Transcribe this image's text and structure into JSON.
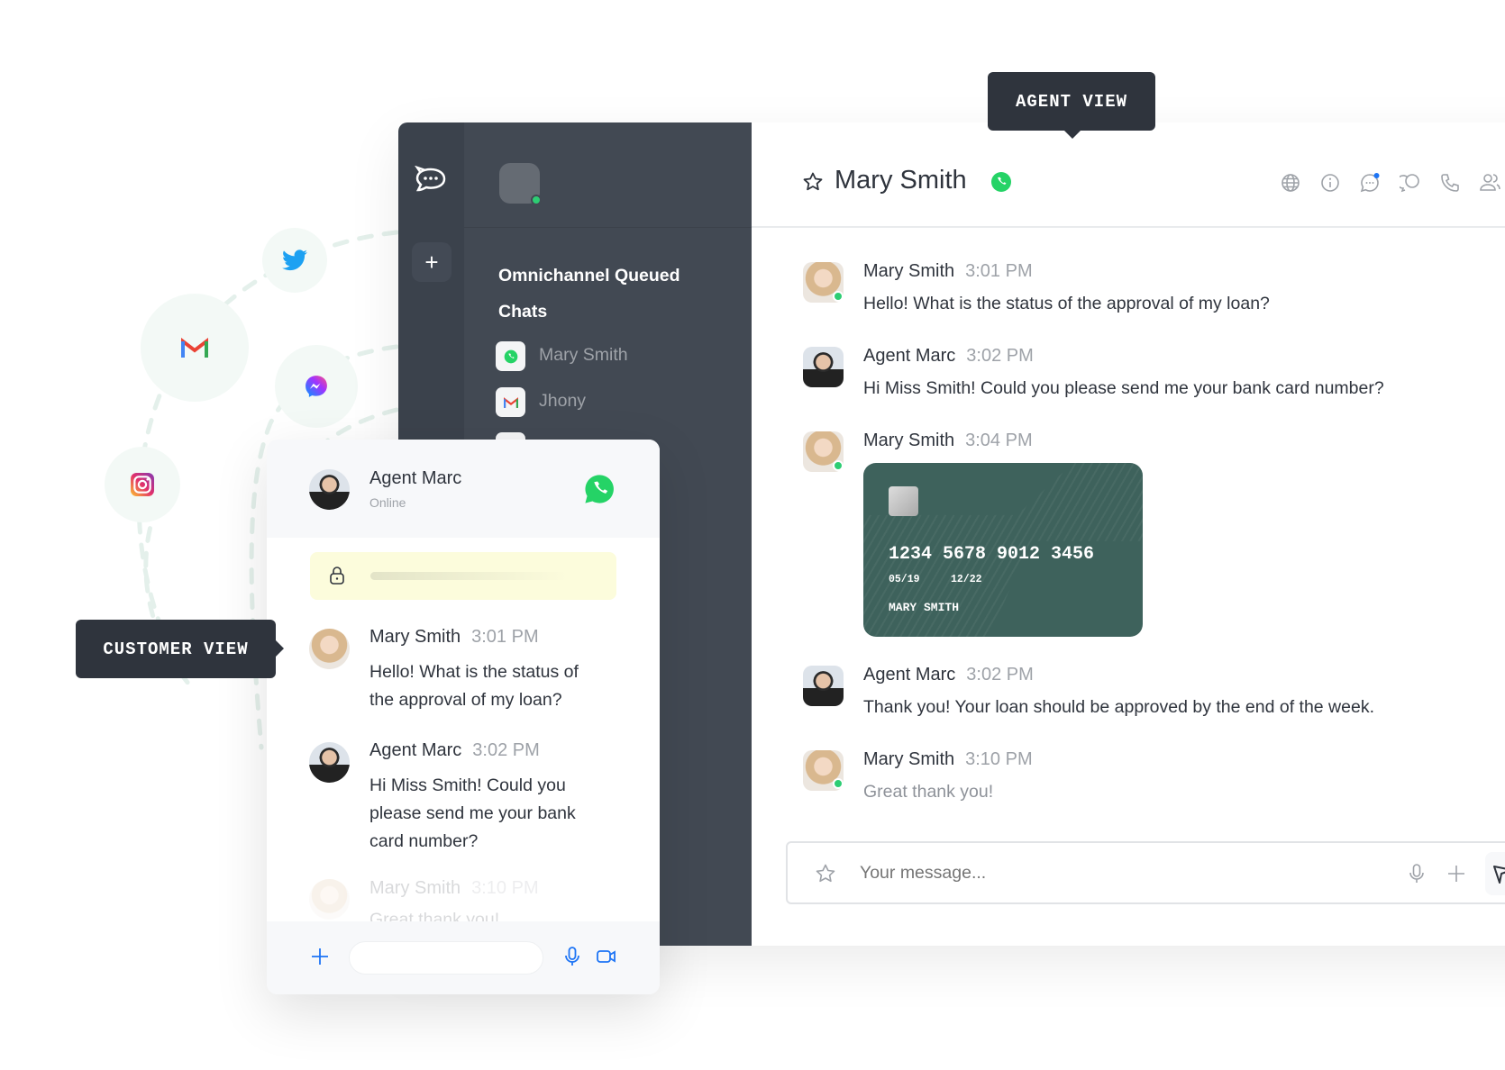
{
  "labels": {
    "agent_view": "AGENT VIEW",
    "customer_view": "CUSTOMER VIEW"
  },
  "social_icons": [
    "twitter-icon",
    "gmail-icon",
    "messenger-icon",
    "instagram-icon"
  ],
  "sidebar": {
    "title": "Omnichannel Queued Chats",
    "items": [
      {
        "label": "Mary Smith",
        "icon": "whatsapp-icon"
      },
      {
        "label": "Jhony",
        "icon": "gmail-icon"
      }
    ]
  },
  "header": {
    "name": "Mary Smith",
    "channel_icon": "whatsapp-icon",
    "actions": [
      "globe-icon",
      "info-icon",
      "discussion-icon",
      "threads-icon",
      "phone-icon",
      "members-icon"
    ]
  },
  "messages": [
    {
      "name": "Mary Smith",
      "time": "3:01 PM",
      "text": "Hello! What is the status of the approval of my loan?"
    },
    {
      "name": "Agent Marc",
      "time": "3:02 PM",
      "text": "Hi Miss Smith! Could you please send me your bank card number?"
    },
    {
      "name": "Mary Smith",
      "time": "3:04 PM",
      "text": ""
    },
    {
      "name": "Agent Marc",
      "time": "3:02 PM",
      "text": "Thank you! Your loan should be approved by the end of the week."
    },
    {
      "name": "Mary Smith",
      "time": "3:10 PM",
      "text": "Great thank you!"
    }
  ],
  "card": {
    "number": "1234 5678 9012 3456",
    "valid_from": "05/19",
    "valid_thru": "12/22",
    "holder": "MARY SMITH"
  },
  "composer": {
    "placeholder": "Your message..."
  },
  "customer": {
    "agent_name": "Agent Marc",
    "agent_status": "Online",
    "messages": [
      {
        "name": "Mary Smith",
        "time": "3:01 PM",
        "text": "Hello! What is the status of the approval of my loan?"
      },
      {
        "name": "Agent Marc",
        "time": "3:02 PM",
        "text": "Hi Miss Smith! Could you please send me your bank card number?"
      },
      {
        "name": "Mary Smith",
        "time": "3:10 PM",
        "text": "Great thank you!"
      }
    ]
  },
  "colors": {
    "whatsapp": "#25d366",
    "online": "#2dcd73",
    "accent_blue": "#1d74f5",
    "card": "#3e625c"
  }
}
